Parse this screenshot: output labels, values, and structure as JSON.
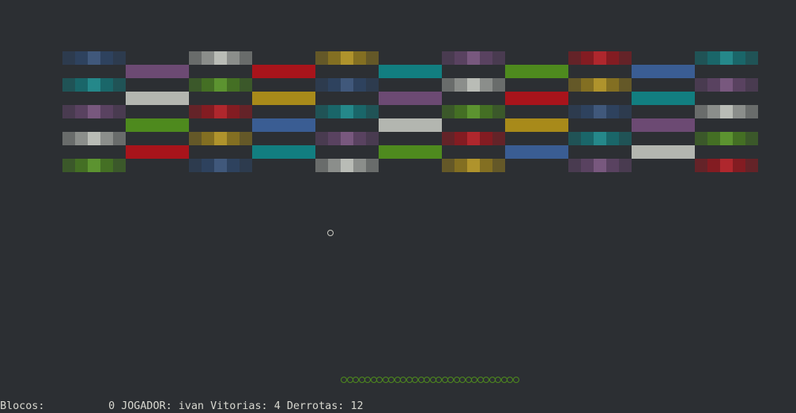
{
  "palette": {
    "navy": "#2f4a70",
    "purple": "#6c4a73",
    "silver": "#b3b6b0",
    "red": "#a8141b",
    "gold": "#a88a1a",
    "teal": "#127e80",
    "green": "#4e8a1e",
    "blue": "#3a5d93"
  },
  "blocks": {
    "striped_rows": [
      [
        "navy",
        "silver",
        "gold",
        "purple",
        "red",
        "teal"
      ],
      [
        "teal",
        "green",
        "navy",
        "silver",
        "gold",
        "purple"
      ],
      [
        "purple",
        "red",
        "teal",
        "green",
        "navy",
        "silver"
      ],
      [
        "silver",
        "gold",
        "purple",
        "red",
        "teal",
        "green"
      ],
      [
        "green",
        "navy",
        "silver",
        "gold",
        "purple",
        "red"
      ]
    ],
    "solid_rows": [
      [
        "purple",
        "red",
        "teal",
        "green",
        "blue"
      ],
      [
        "silver",
        "gold",
        "purple",
        "red",
        "teal"
      ],
      [
        "green",
        "blue",
        "silver",
        "gold",
        "purple"
      ],
      [
        "red",
        "teal",
        "green",
        "blue",
        "silver"
      ]
    ]
  },
  "ball": {
    "glyph": "circle-outline"
  },
  "paddle": {
    "segments": 30,
    "color": "#4e8a1e"
  },
  "status": {
    "blocks_label": "Blocos:",
    "blocks_value": "0",
    "player_label": "JOGADOR:",
    "player_name": "ivan",
    "wins_label": "Vitorias:",
    "wins_value": "4",
    "losses_label": "Derrotas:",
    "losses_value": "12"
  }
}
